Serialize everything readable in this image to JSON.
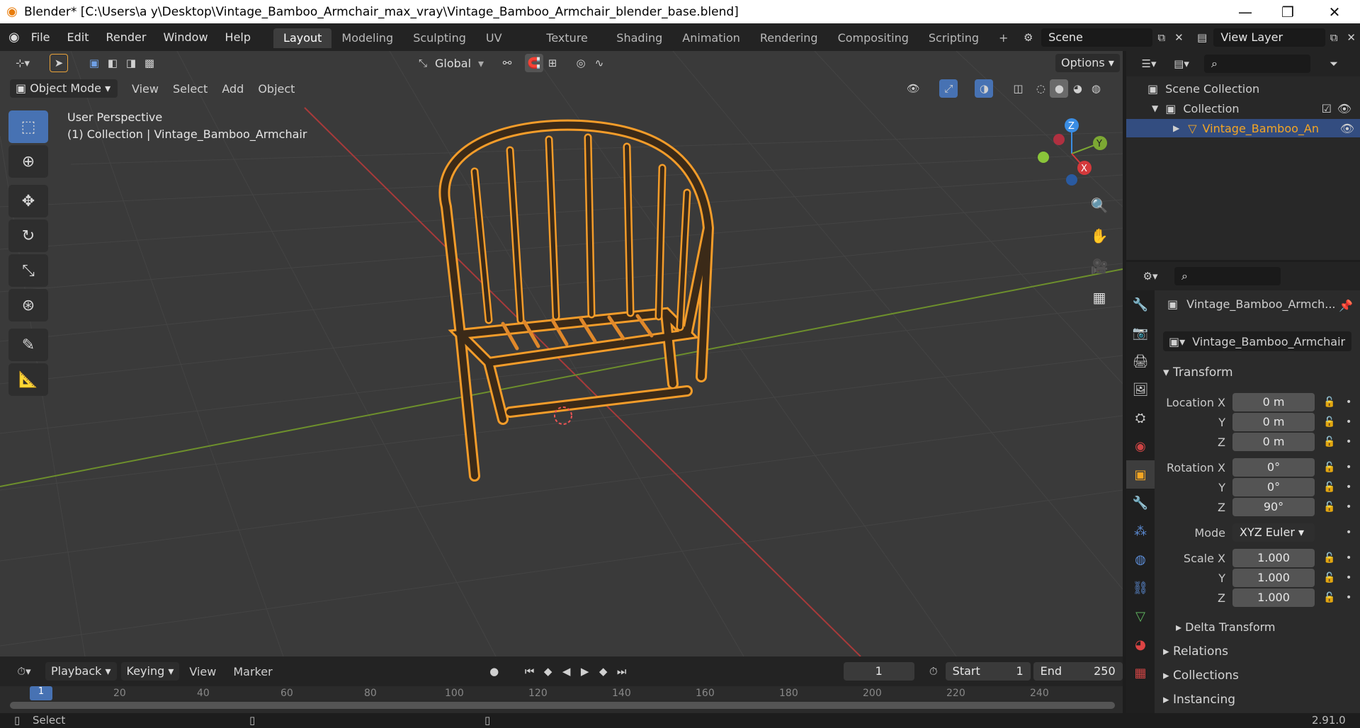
{
  "titlebar": {
    "title": "Blender* [C:\\Users\\a y\\Desktop\\Vintage_Bamboo_Armchair_max_vray\\Vintage_Bamboo_Armchair_blender_base.blend]"
  },
  "menu": [
    "File",
    "Edit",
    "Render",
    "Window",
    "Help"
  ],
  "workspaces": [
    "Layout",
    "Modeling",
    "Sculpting",
    "UV Editing",
    "Texture Paint",
    "Shading",
    "Animation",
    "Rendering",
    "Compositing",
    "Scripting"
  ],
  "active_workspace": "Layout",
  "scene": "Scene",
  "view_layer": "View Layer",
  "header": {
    "orientation": "Global",
    "options": "Options"
  },
  "viewport_menu": {
    "mode": "Object Mode",
    "items": [
      "View",
      "Select",
      "Add",
      "Object"
    ]
  },
  "viewport": {
    "perspective": "User Perspective",
    "collection_label": "(1) Collection | Vintage_Bamboo_Armchair"
  },
  "gizmo": {
    "x": "X",
    "y": "Y",
    "z": "Z"
  },
  "outliner": {
    "scene_collection": "Scene Collection",
    "collection": "Collection",
    "object": "Vintage_Bamboo_An"
  },
  "properties": {
    "object_name": "Vintage_Bamboo_Armch...",
    "object_field": "Vintage_Bamboo_Armchair",
    "transform_label": "Transform",
    "location": {
      "label": "Location X",
      "x": "0 m",
      "y": "0 m",
      "z": "0 m"
    },
    "rotation": {
      "label": "Rotation X",
      "x": "0°",
      "y": "0°",
      "z": "90°"
    },
    "mode_label": "Mode",
    "mode": "XYZ Euler",
    "scale": {
      "label": "Scale X",
      "x": "1.000",
      "y": "1.000",
      "z": "1.000"
    },
    "axis_y": "Y",
    "axis_z": "Z",
    "sections": [
      "Delta Transform",
      "Relations",
      "Collections",
      "Instancing"
    ]
  },
  "timeline": {
    "menus": [
      "Playback",
      "Keying",
      "View",
      "Marker"
    ],
    "current_frame": "1",
    "start_label": "Start",
    "start": "1",
    "end_label": "End",
    "end": "250",
    "ruler": [
      "1",
      "20",
      "40",
      "60",
      "80",
      "100",
      "120",
      "140",
      "160",
      "180",
      "200",
      "220",
      "240"
    ]
  },
  "status": {
    "left": "Select",
    "version": "2.91.0"
  },
  "colors": {
    "accent": "#4772b3",
    "selection": "#f5a623",
    "x_axis": "#d4393b",
    "y_axis": "#7ca833",
    "z_axis": "#3a8de4"
  }
}
